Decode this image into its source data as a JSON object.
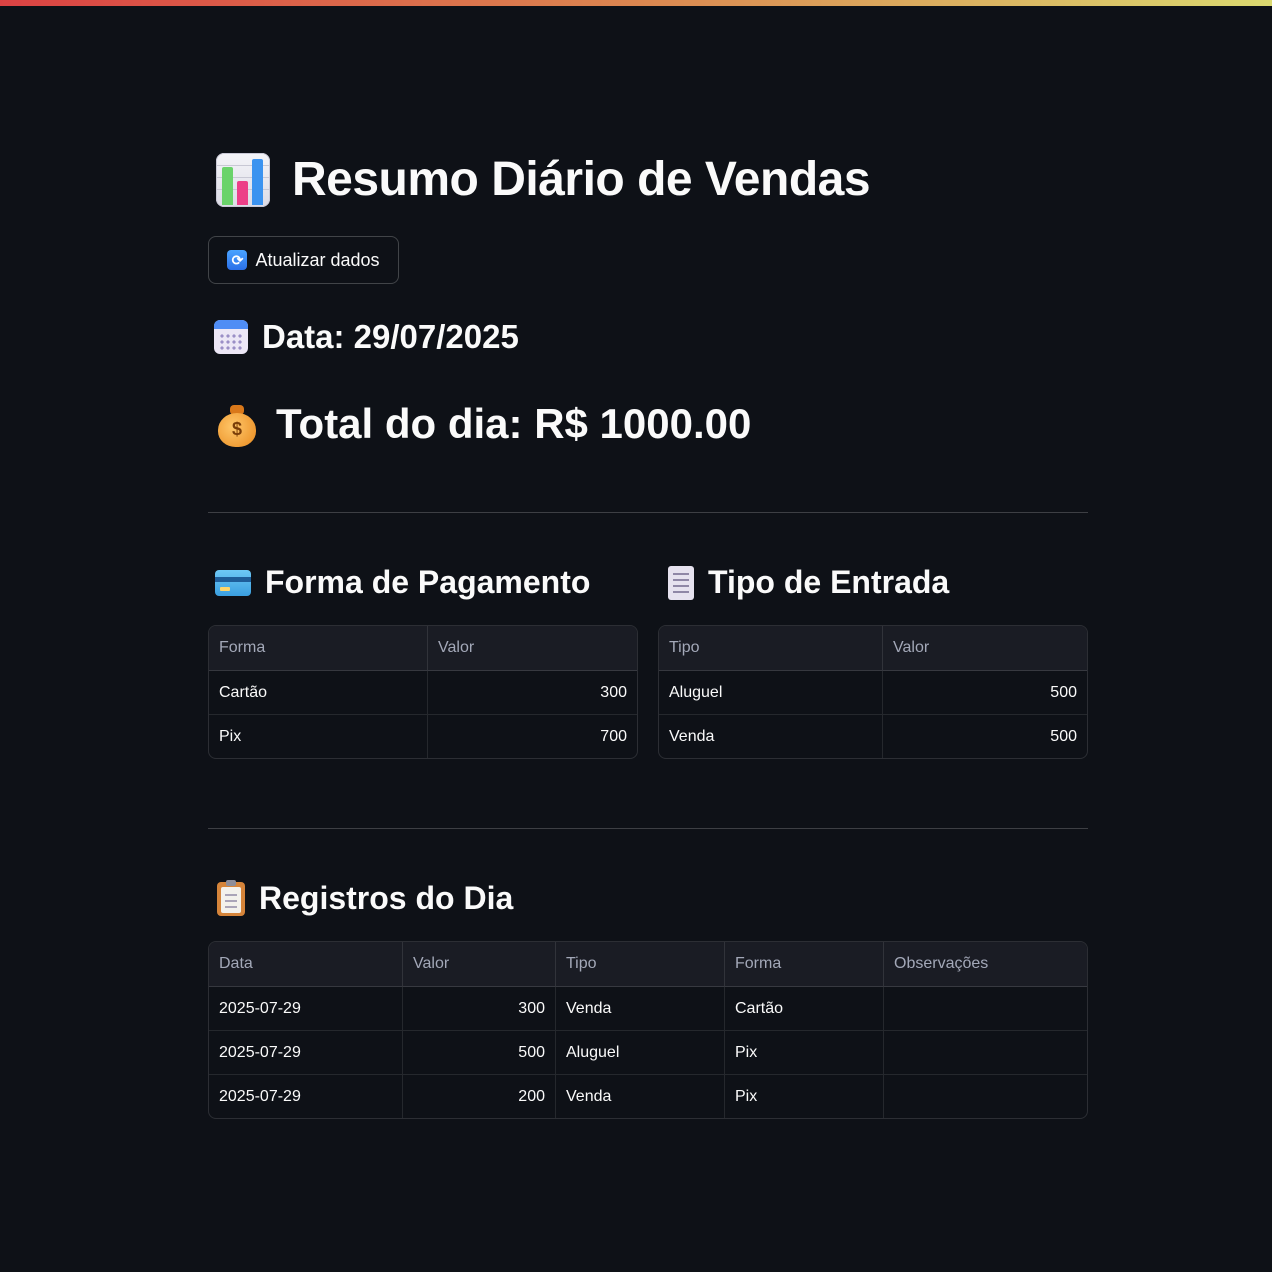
{
  "page": {
    "title": "Resumo Diário de Vendas",
    "refresh_button": "Atualizar dados",
    "date_heading": "Data: 29/07/2025",
    "total_heading": "Total do dia: R$ 1000.00"
  },
  "icons": {
    "title": "bar-chart-icon",
    "refresh": "refresh-icon",
    "date": "calendar-icon",
    "total": "money-bag-icon",
    "payment": "credit-card-icon",
    "entry_type": "receipt-icon",
    "records": "clipboard-icon"
  },
  "payment_section": {
    "heading": "Forma de Pagamento",
    "columns": [
      "Forma",
      "Valor"
    ],
    "rows": [
      [
        "Cartão",
        "300"
      ],
      [
        "Pix",
        "700"
      ]
    ]
  },
  "type_section": {
    "heading": "Tipo de Entrada",
    "columns": [
      "Tipo",
      "Valor"
    ],
    "rows": [
      [
        "Aluguel",
        "500"
      ],
      [
        "Venda",
        "500"
      ]
    ]
  },
  "records_section": {
    "heading": "Registros do Dia",
    "columns": [
      "Data",
      "Valor",
      "Tipo",
      "Forma",
      "Observações"
    ],
    "rows": [
      [
        "2025-07-29",
        "300",
        "Venda",
        "Cartão",
        ""
      ],
      [
        "2025-07-29",
        "500",
        "Aluguel",
        "Pix",
        ""
      ],
      [
        "2025-07-29",
        "200",
        "Venda",
        "Pix",
        ""
      ]
    ]
  },
  "colors": {
    "background": "#0e1117",
    "text": "#fafafa",
    "header_bg": "#1a1c24",
    "accent": "#ff4b4b"
  }
}
